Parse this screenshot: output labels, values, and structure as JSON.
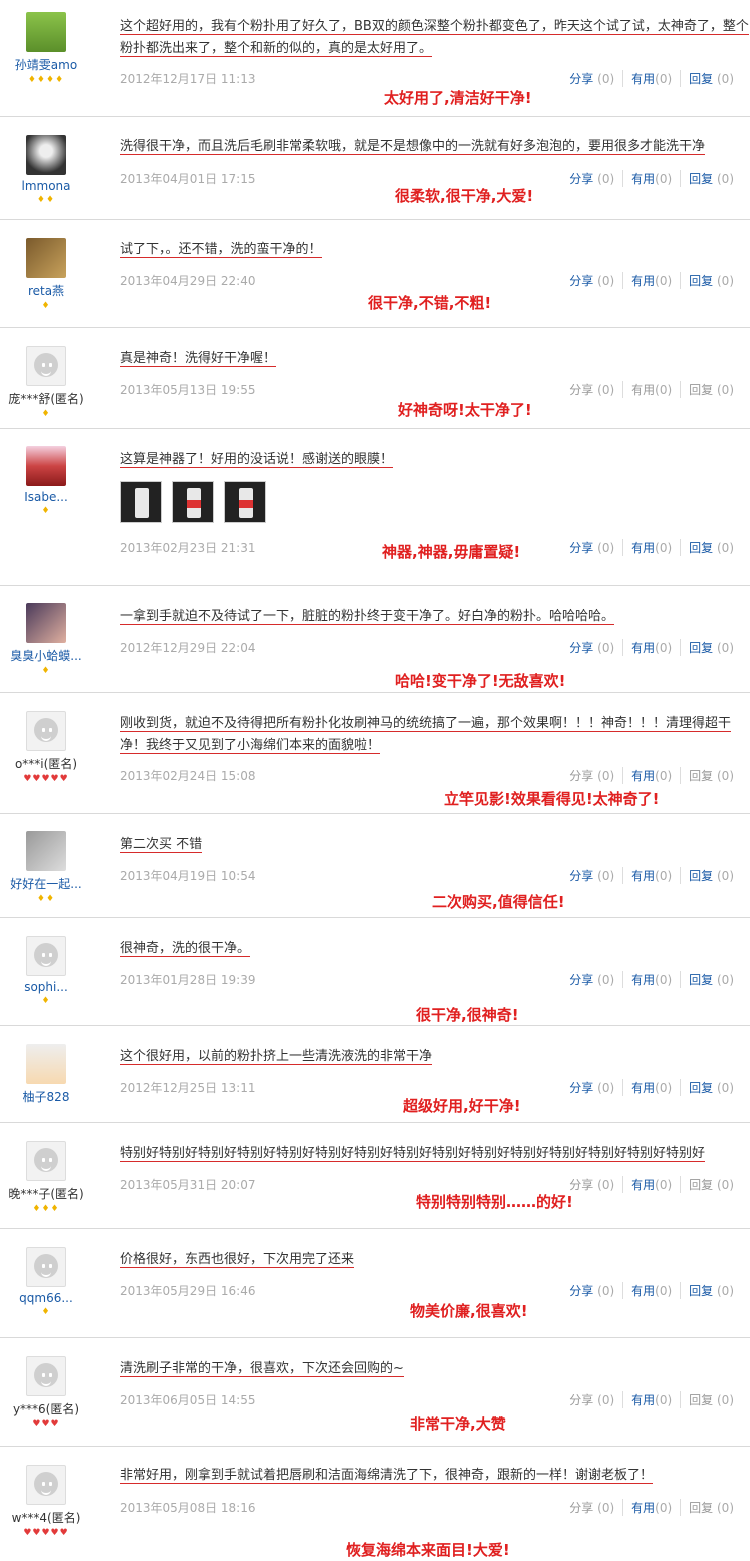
{
  "labels": {
    "share": "分享",
    "useful": "有用",
    "reply": "回复"
  },
  "reviews": [
    {
      "user": "孙靖雯amo",
      "rank": "♦♦♦♦",
      "content": "这个超好用的，我有个粉扑用了好久了，BB双的颜色深整个粉扑都变色了，昨天这个试了试，太神奇了，整个粉扑都洗出来了，整个和新的似的，真的是太好用了。",
      "date": "2012年12月17日 11:13",
      "share": "(0)",
      "useful": "(0)",
      "reply": "(0)",
      "note": "太好用了,清洁好干净!"
    },
    {
      "user": "lmmona",
      "rank": "♦♦",
      "content": "洗得很干净，而且洗后毛刷非常柔软哦，就是不是想像中的一洗就有好多泡泡的，要用很多才能洗干净",
      "date": "2013年04月01日 17:15",
      "share": "(0)",
      "useful": "(0)",
      "reply": "(0)",
      "note": "很柔软,很干净,大爱!"
    },
    {
      "user": "reta燕",
      "rank": "♦",
      "content": "试了下，。还不错，洗的蛮干净的！",
      "date": "2013年04月29日 22:40",
      "share": "(0)",
      "useful": "(0)",
      "reply": "(0)",
      "note": "很干净,不错,不粗!"
    },
    {
      "user": "庞***舒(匿名)",
      "rank": "♦",
      "content": "真是神奇！洗得好干净喔！",
      "date": "2013年05月13日 19:55",
      "share": "(0)",
      "useful": "(0)",
      "reply": "(0)",
      "note": "好神奇呀!太干净了!"
    },
    {
      "user": "Isabe...",
      "rank": "♦",
      "content": "这算是神器了！好用的没话说！感谢送的眼膜！",
      "date": "2013年02月23日 21:31",
      "share": "(0)",
      "useful": "(0)",
      "reply": "(0)",
      "note": "神器,神器,毋庸置疑!"
    },
    {
      "user": "臭臭小蛤蟆...",
      "rank": "♦",
      "content": "一拿到手就迫不及待试了一下，脏脏的粉扑终于变干净了。好白净的粉扑。哈哈哈哈。",
      "date": "2012年12月29日 22:04",
      "share": "(0)",
      "useful": "(0)",
      "reply": "(0)",
      "note": "哈哈!变干净了!无敌喜欢!"
    },
    {
      "user": "o***i(匿名)",
      "rank": "♥♥♥♥♥",
      "content": "刚收到货，就迫不及待得把所有粉扑化妆刷神马的统统搞了一遍，那个效果啊！！！神奇！！！清理得超干净！我终于又见到了小海绵们本来的面貌啦！",
      "date": "2013年02月24日 15:08",
      "share": "(0)",
      "useful": "(0)",
      "reply": "(0)",
      "note": "立竿见影!效果看得见!太神奇了!"
    },
    {
      "user": "好好在一起...",
      "rank": "♦♦",
      "content": "第二次买 不错",
      "date": "2013年04月19日 10:54",
      "share": "(0)",
      "useful": "(0)",
      "reply": "(0)",
      "note": "二次购买,值得信任!"
    },
    {
      "user": "sophi...",
      "rank": "♦",
      "content": "很神奇，洗的很干净。",
      "date": "2013年01月28日 19:39",
      "share": "(0)",
      "useful": "(0)",
      "reply": "(0)",
      "note": "很干净,很神奇!"
    },
    {
      "user": "柚子828",
      "rank": "",
      "content": "这个很好用，以前的粉扑挤上一些清洗液洗的非常干净",
      "date": "2012年12月25日 13:11",
      "share": "(0)",
      "useful": "(0)",
      "reply": "(0)",
      "note": "超级好用,好干净!"
    },
    {
      "user": "晚***子(匿名)",
      "rank": "♦♦♦",
      "content": "特别好特别好特别好特别好特别好特别好特别好特别好特别好特别好特别好特别好特别好特别好特别好",
      "date": "2013年05月31日 20:07",
      "share": "(0)",
      "useful": "(0)",
      "reply": "(0)",
      "note": "特别特别特别……的好!"
    },
    {
      "user": "qqm66...",
      "rank": "♦",
      "content": "价格很好，东西也很好，下次用完了还来",
      "date": "2013年05月29日 16:46",
      "share": "(0)",
      "useful": "(0)",
      "reply": "(0)",
      "note": "物美价廉,很喜欢!"
    },
    {
      "user": "y***6(匿名)",
      "rank": "♥♥♥",
      "content": "清洗刷子非常的干净，很喜欢，下次还会回购的~",
      "date": "2013年06月05日 14:55",
      "share": "(0)",
      "useful": "(0)",
      "reply": "(0)",
      "note": "非常干净,大赞"
    },
    {
      "user": "w***4(匿名)",
      "rank": "♥♥♥♥♥",
      "content": "非常好用，刚拿到手就试着把唇刷和洁面海绵清洗了下，很神奇，跟新的一样！谢谢老板了！",
      "date": "2013年05月08日 18:16",
      "share": "(0)",
      "useful": "(0)",
      "reply": "(0)",
      "note": "恢复海绵本来面目!大爱!"
    }
  ]
}
